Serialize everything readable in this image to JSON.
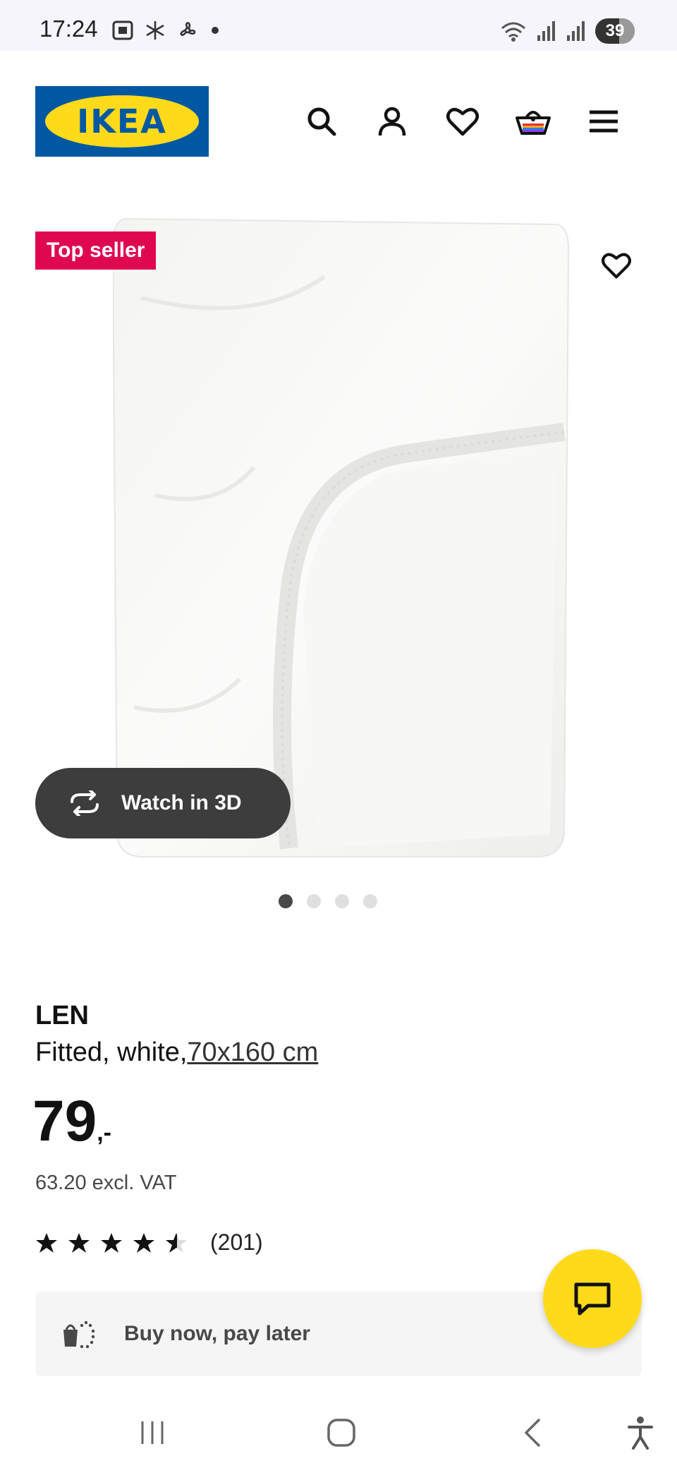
{
  "status_bar": {
    "time": "17:24",
    "battery": "39",
    "icons": [
      "screenshot-icon",
      "snowflake-icon",
      "fan-icon",
      "dot-icon",
      "wifi-icon",
      "signal-icon",
      "signal-r-icon"
    ]
  },
  "header": {
    "logo_text": "IKEA",
    "icons": [
      "search-icon",
      "account-icon",
      "heart-icon",
      "basket-icon",
      "menu-icon"
    ]
  },
  "gallery": {
    "badge": "Top seller",
    "watch_3d_label": "Watch in 3D",
    "slide_count": 4,
    "active_slide": 1
  },
  "product": {
    "name": "LEN",
    "description_prefix": "Fitted, white,",
    "size": "70x160 cm",
    "price_main": "79",
    "price_suffix": ",-",
    "price_excl_vat": "63.20 excl. VAT",
    "rating": 4.5,
    "rating_max": 5,
    "review_count": "(201)"
  },
  "bnpl": {
    "label": "Buy now, pay later"
  },
  "colors": {
    "ikea_blue": "#0058a3",
    "ikea_yellow": "#ffda1a",
    "badge_red": "#e00751"
  },
  "nav": {
    "buttons": [
      "recents-icon",
      "home-icon",
      "back-icon",
      "accessibility-icon"
    ]
  }
}
